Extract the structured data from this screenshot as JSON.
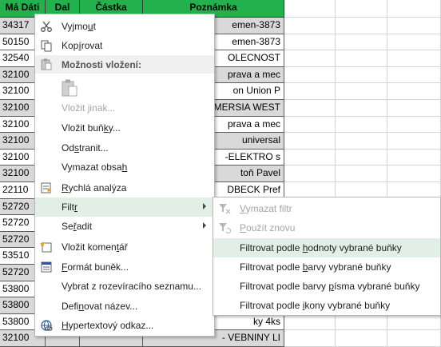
{
  "sheet": {
    "headers": [
      "Má Dáti",
      "Dal",
      "Částka",
      "Poznámka"
    ],
    "rows": [
      {
        "a": "34317",
        "d": "emen-3873",
        "grey": true
      },
      {
        "a": "50150",
        "d": "emen-3873",
        "grey": false
      },
      {
        "a": "32540",
        "d": "OLECNOST",
        "grey": false
      },
      {
        "a": "32100",
        "d": "prava a mec",
        "grey": true
      },
      {
        "a": "32100",
        "d": "on Union P",
        "grey": false
      },
      {
        "a": "32100",
        "d": "MERSIA WEST",
        "grey": true
      },
      {
        "a": "32100",
        "d": "prava a mec",
        "grey": false
      },
      {
        "a": "32100",
        "d": "universal",
        "grey": true
      },
      {
        "a": "32100",
        "d": "-ELEKTRO s",
        "grey": false
      },
      {
        "a": "32100",
        "d": "toň Pavel",
        "grey": true
      },
      {
        "a": "22110",
        "d": "DBECK Pref",
        "grey": false
      },
      {
        "a": "52720",
        "d": "",
        "grey": true
      },
      {
        "a": "52720",
        "d": "",
        "grey": false
      },
      {
        "a": "52720",
        "d": "",
        "grey": true
      },
      {
        "a": "53510",
        "d": "",
        "grey": false
      },
      {
        "a": "52720",
        "d": "",
        "grey": true
      },
      {
        "a": "53800",
        "d": "",
        "grey": false
      },
      {
        "a": "53800",
        "d": "",
        "grey": true
      },
      {
        "a": "53800",
        "d": "ky 4ks",
        "grey": false
      },
      {
        "a": "32100",
        "d": "- VEBNINY LI",
        "grey": true
      }
    ]
  },
  "context_menu": {
    "cut": {
      "pre": "Vyjmo",
      "key": "u",
      "post": "t"
    },
    "copy": {
      "pre": "Kop",
      "key": "í",
      "post": "rovat"
    },
    "paste_options": "Možnosti vložení:",
    "paste_special": {
      "pre": "Vložit ",
      "key": "j",
      "post": "inak..."
    },
    "insert_cells": {
      "pre": "Vložit buň",
      "key": "k",
      "post": "y..."
    },
    "delete": {
      "pre": "Od",
      "key": "s",
      "post": "tranit..."
    },
    "clear": {
      "pre": "Vymazat obsa",
      "key": "h",
      "post": ""
    },
    "quick_analysis": {
      "pre": "",
      "key": "R",
      "post": "ychlá analýza"
    },
    "filter": {
      "pre": "Filt",
      "key": "r",
      "post": ""
    },
    "sort": {
      "pre": "Se",
      "key": "ř",
      "post": "adit"
    },
    "insert_comment": {
      "pre": "Vložit komen",
      "key": "t",
      "post": "ář"
    },
    "format_cells": {
      "pre": "",
      "key": "F",
      "post": "ormát buněk..."
    },
    "pick_from_list": {
      "pre": "Vybrat z rozevíracího seznamu",
      "key": "",
      "post": "..."
    },
    "define_name": {
      "pre": "Defi",
      "key": "n",
      "post": "ovat název..."
    },
    "hyperlink": {
      "pre": "",
      "key": "H",
      "post": "ypertextový odkaz..."
    }
  },
  "filter_submenu": {
    "clear_filter": {
      "pre": "",
      "key": "V",
      "post": "ymazat filtr"
    },
    "reapply": {
      "pre": "",
      "key": "P",
      "post": "oužít znovu"
    },
    "by_value": {
      "pre": "Filtrovat podle ",
      "key": "h",
      "post": "odnoty vybrané buňky"
    },
    "by_color": {
      "pre": "Filtrovat podle ",
      "key": "b",
      "post": "arvy vybrané buňky"
    },
    "by_font_color": {
      "pre": "Filtrovat podle barvy ",
      "key": "p",
      "post": "ísma vybrané buňky"
    },
    "by_icon": {
      "pre": "Filtrovat podle ",
      "key": "i",
      "post": "kony vybrané buňky"
    }
  },
  "colors": {
    "header_green": "#22b14c",
    "highlight": "#e1efe6",
    "icon_blue": "#2b579a"
  }
}
